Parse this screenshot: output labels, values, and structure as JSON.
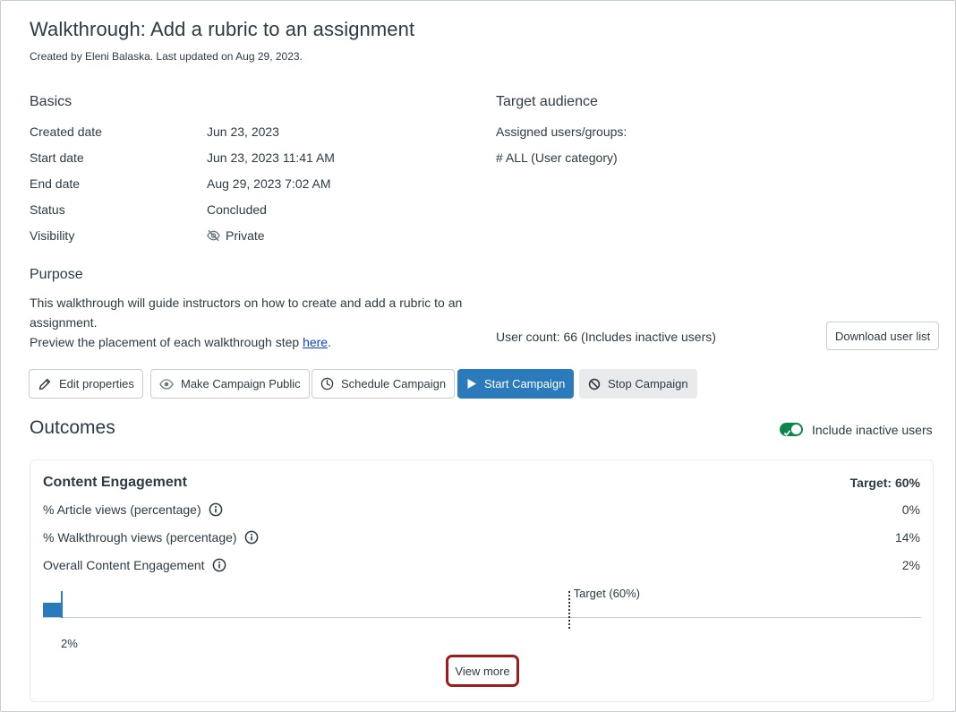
{
  "header": {
    "title": "Walkthrough: Add a rubric to an assignment",
    "subtitle": "Created by Eleni Balaska. Last updated on Aug 29, 2023."
  },
  "basics": {
    "heading": "Basics",
    "rows": [
      {
        "label": "Created date",
        "value": "Jun 23, 2023"
      },
      {
        "label": "Start date",
        "value": "Jun 23, 2023 11:41 AM"
      },
      {
        "label": "End date",
        "value": "Aug 29, 2023 7:02 AM"
      },
      {
        "label": "Status",
        "value": "Concluded"
      },
      {
        "label": "Visibility",
        "value": "Private",
        "icon": "eye-slash-icon"
      }
    ]
  },
  "audience": {
    "heading": "Target audience",
    "assigned_label": "Assigned users/groups:",
    "group": "# ALL (User category)",
    "user_count": "User count: 66 (Includes inactive users)",
    "download_label": "Download user list"
  },
  "purpose": {
    "heading": "Purpose",
    "text": "This walkthrough will guide instructors on how to create and add a rubric to an assignment.",
    "preview_text": "Preview the placement of each walkthrough step ",
    "preview_link": "here",
    "preview_suffix": "."
  },
  "actions": {
    "edit": "Edit properties",
    "make_public": "Make Campaign Public",
    "schedule": "Schedule Campaign",
    "start": "Start Campaign",
    "stop": "Stop Campaign"
  },
  "outcomes": {
    "title": "Outcomes",
    "include_inactive_label": "Include inactive users",
    "include_inactive_on": true,
    "card": {
      "title": "Content Engagement",
      "target": "Target: 60%",
      "metrics": [
        {
          "label": "% Article views (percentage)",
          "value": "0%"
        },
        {
          "label": "% Walkthrough views (percentage)",
          "value": "14%"
        },
        {
          "label": "Overall Content Engagement",
          "value": "2%"
        }
      ],
      "progress": {
        "value_percent": 2,
        "value_label": "2%",
        "target_percent": 60,
        "target_label": "Target (60%)"
      },
      "view_more": "View more"
    }
  },
  "colors": {
    "primary": "#2b7abc",
    "toggle_on": "#0b874b",
    "highlight": "#9b1c1c",
    "text": "#2d3b45",
    "link": "#0b3fd8"
  }
}
